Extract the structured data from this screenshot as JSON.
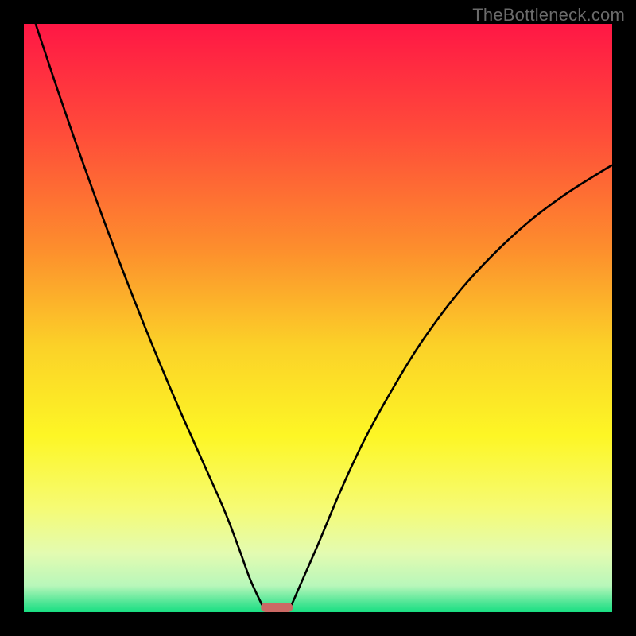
{
  "watermark": "TheBottleneck.com",
  "chart_data": {
    "type": "line",
    "title": "",
    "xlabel": "",
    "ylabel": "",
    "xlim": [
      0,
      100
    ],
    "ylim": [
      0,
      100
    ],
    "grid": false,
    "legend": false,
    "gradient_stops": [
      {
        "offset": 0.0,
        "color": "#ff1745"
      },
      {
        "offset": 0.18,
        "color": "#ff4a3a"
      },
      {
        "offset": 0.38,
        "color": "#fd8d2d"
      },
      {
        "offset": 0.55,
        "color": "#fbd228"
      },
      {
        "offset": 0.7,
        "color": "#fdf625"
      },
      {
        "offset": 0.82,
        "color": "#f6fb72"
      },
      {
        "offset": 0.9,
        "color": "#e3fbb1"
      },
      {
        "offset": 0.955,
        "color": "#b8f7ba"
      },
      {
        "offset": 0.985,
        "color": "#4ae594"
      },
      {
        "offset": 1.0,
        "color": "#18df82"
      }
    ],
    "series": [
      {
        "name": "left-curve",
        "x": [
          2,
          6,
          10,
          14,
          18,
          22,
          26,
          30,
          34,
          36.5,
          38.5,
          40.5
        ],
        "y": [
          100,
          88,
          76.5,
          65.5,
          55,
          45,
          35.5,
          26.5,
          17.5,
          11,
          5.5,
          1.2
        ]
      },
      {
        "name": "right-curve",
        "x": [
          45.5,
          47.5,
          50,
          54,
          58,
          63,
          68,
          74,
          80,
          86,
          92,
          98,
          100
        ],
        "y": [
          1.2,
          5.8,
          11.5,
          21,
          29.5,
          38.5,
          46.5,
          54.5,
          61,
          66.5,
          71,
          74.8,
          76
        ]
      }
    ],
    "optimal_marker": {
      "x_center": 43,
      "width": 5.4,
      "height": 1.6
    },
    "annotations": []
  }
}
